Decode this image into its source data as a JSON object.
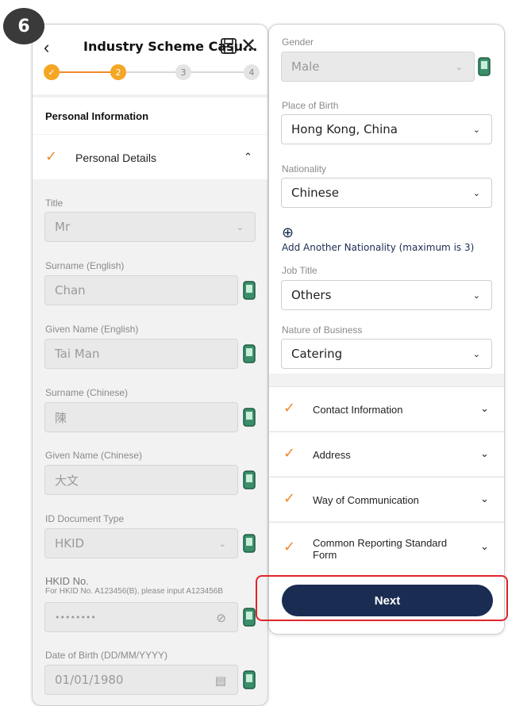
{
  "step_badge": "6",
  "header": {
    "title": "Industry Scheme Casu...",
    "steps": [
      "✓",
      "2",
      "3",
      "4"
    ]
  },
  "left": {
    "section_title": "Personal Information",
    "accordion_label": "Personal Details",
    "fields": {
      "title": {
        "label": "Title",
        "value": "Mr"
      },
      "surname_en": {
        "label": "Surname (English)",
        "value": "Chan"
      },
      "given_en": {
        "label": "Given Name (English)",
        "value": "Tai Man"
      },
      "surname_zh": {
        "label": "Surname (Chinese)",
        "value": "陳"
      },
      "given_zh": {
        "label": "Given Name (Chinese)",
        "value": "大文"
      },
      "id_type": {
        "label": "ID Document Type",
        "value": "HKID"
      },
      "hkid": {
        "label": "HKID No.",
        "hint": "For HKID No. A123456(B), please input A123456B",
        "value": "••••••••"
      },
      "dob": {
        "label": "Date of Birth (DD/MM/YYYY)",
        "value": "01/01/1980"
      }
    }
  },
  "right": {
    "fields": {
      "gender": {
        "label": "Gender",
        "value": "Male"
      },
      "place_of_birth": {
        "label": "Place of Birth",
        "value": "Hong Kong, China"
      },
      "nationality": {
        "label": "Nationality",
        "value": "Chinese"
      },
      "job_title": {
        "label": "Job Title",
        "value": "Others"
      },
      "nature_of_business": {
        "label": "Nature of Business",
        "value": "Catering"
      }
    },
    "add_nationality": "Add Another Nationality (maximum is 3)",
    "accordions": [
      "Contact Information",
      "Address",
      "Way of Communication",
      "Common Reporting Standard Form"
    ],
    "next_label": "Next"
  },
  "colors": {
    "accent": "#f08a2c",
    "primary": "#1b2c52",
    "highlight": "#e0262b"
  }
}
